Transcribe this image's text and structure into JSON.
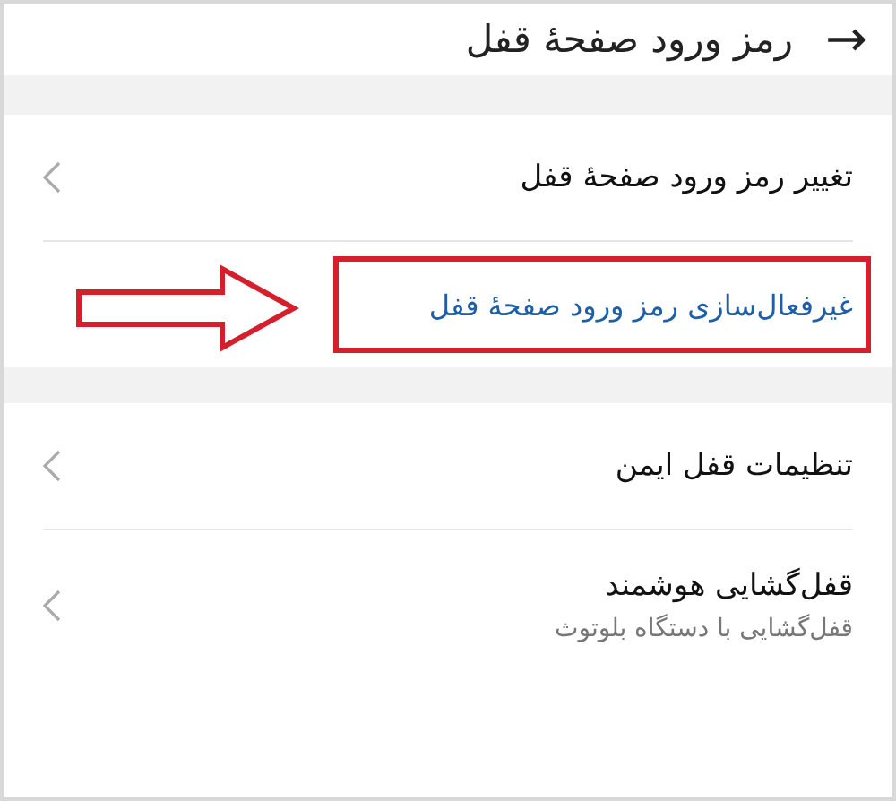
{
  "header": {
    "title": "رمز ورود صفحهٔ قفل",
    "back_icon": "→"
  },
  "groups": [
    {
      "items": [
        {
          "kind": "nav",
          "title": "تغییر رمز ورود صفحهٔ قفل",
          "annotated": false
        },
        {
          "kind": "action",
          "title": "غیرفعال‌سازی رمز ورود صفحهٔ قفل",
          "annotated": true
        }
      ]
    },
    {
      "items": [
        {
          "kind": "nav",
          "title": "تنظیمات قفل ایمن",
          "annotated": false
        },
        {
          "kind": "nav",
          "title": "قفل‌گشایی هوشمند",
          "subtitle": "قفل‌گشایی با دستگاه بلوتوث",
          "annotated": false
        }
      ]
    }
  ]
}
